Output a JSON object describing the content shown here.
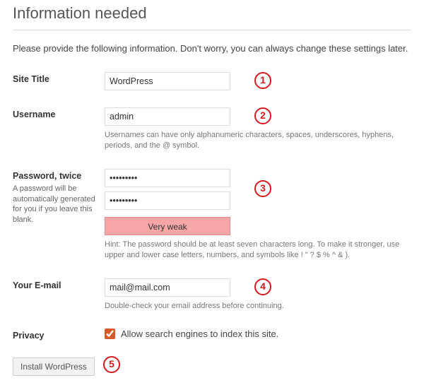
{
  "heading": "Information needed",
  "intro": "Please provide the following information. Don't worry, you can always change these settings later.",
  "fields": {
    "site_title": {
      "label": "Site Title",
      "value": "WordPress"
    },
    "username": {
      "label": "Username",
      "value": "admin",
      "hint": "Usernames can have only alphanumeric characters, spaces, underscores, hyphens, periods, and the @ symbol."
    },
    "password": {
      "label": "Password, twice",
      "sublabel": "A password will be automatically generated for you if you leave this blank.",
      "value1": "•••••••••",
      "value2": "•••••••••",
      "strength_label": "Very weak",
      "hint": "Hint: The password should be at least seven characters long. To make it stronger, use upper and lower case letters, numbers, and symbols like ! \" ? $ % ^ & )."
    },
    "email": {
      "label": "Your E-mail",
      "value": "mail@mail.com",
      "hint": "Double-check your email address before continuing."
    },
    "privacy": {
      "label": "Privacy",
      "checkbox_label": "Allow search engines to index this site.",
      "checked": true
    }
  },
  "submit_label": "Install WordPress",
  "callouts": {
    "n1": "1",
    "n2": "2",
    "n3": "3",
    "n4": "4",
    "n5": "5"
  }
}
